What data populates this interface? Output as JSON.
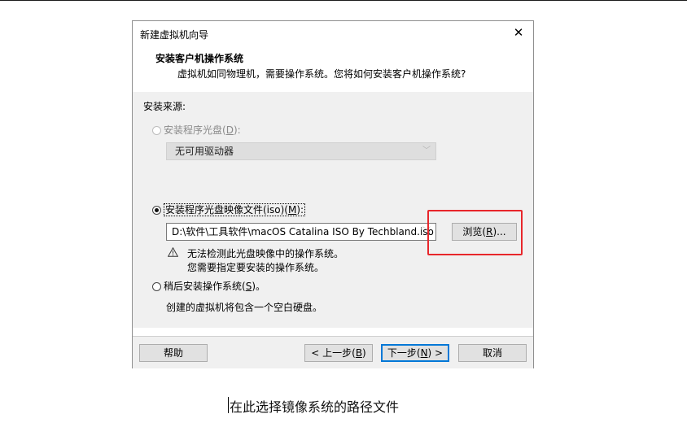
{
  "dialog": {
    "title": "新建虚拟机向导",
    "close_glyph": "✕"
  },
  "header": {
    "title": "安装客户机操作系统",
    "subtitle": "虚拟机如同物理机，需要操作系统。您将如何安装客户机操作系统?"
  },
  "source": {
    "label": "安装来源:",
    "disc_option": {
      "text": "安装程序光盘(",
      "mnemonic": "D",
      "suffix": "):"
    },
    "disc_select_value": "无可用驱动器",
    "iso_option": {
      "text": "安装程序光盘映像文件(iso)(",
      "mnemonic": "M",
      "suffix": "):"
    },
    "iso_path": "D:\\软件\\工具软件\\macOS Catalina ISO By Techbland.iso",
    "browse_button": {
      "text": "浏览(",
      "mnemonic": "R",
      "suffix": ")..."
    },
    "warning_line1": "无法检测此光盘映像中的操作系统。",
    "warning_line2": "您需要指定要安装的操作系统。",
    "later_option": {
      "text": "稍后安装操作系统(",
      "mnemonic": "S",
      "suffix": ")。"
    },
    "later_desc": "创建的虚拟机将包含一个空白硬盘。"
  },
  "footer": {
    "help": "帮助",
    "back": {
      "text": "< 上一步(",
      "mnemonic": "B",
      "suffix": ")"
    },
    "next": {
      "text": "下一步(",
      "mnemonic": "N",
      "suffix": ") >"
    },
    "cancel": "取消"
  },
  "caption": "在此选择镜像系统的路径文件",
  "colors": {
    "highlight": "#e8262b",
    "accent": "#0078d7"
  },
  "icons": {
    "warning": "warning-icon",
    "dropdown": "chevron-down-icon"
  }
}
